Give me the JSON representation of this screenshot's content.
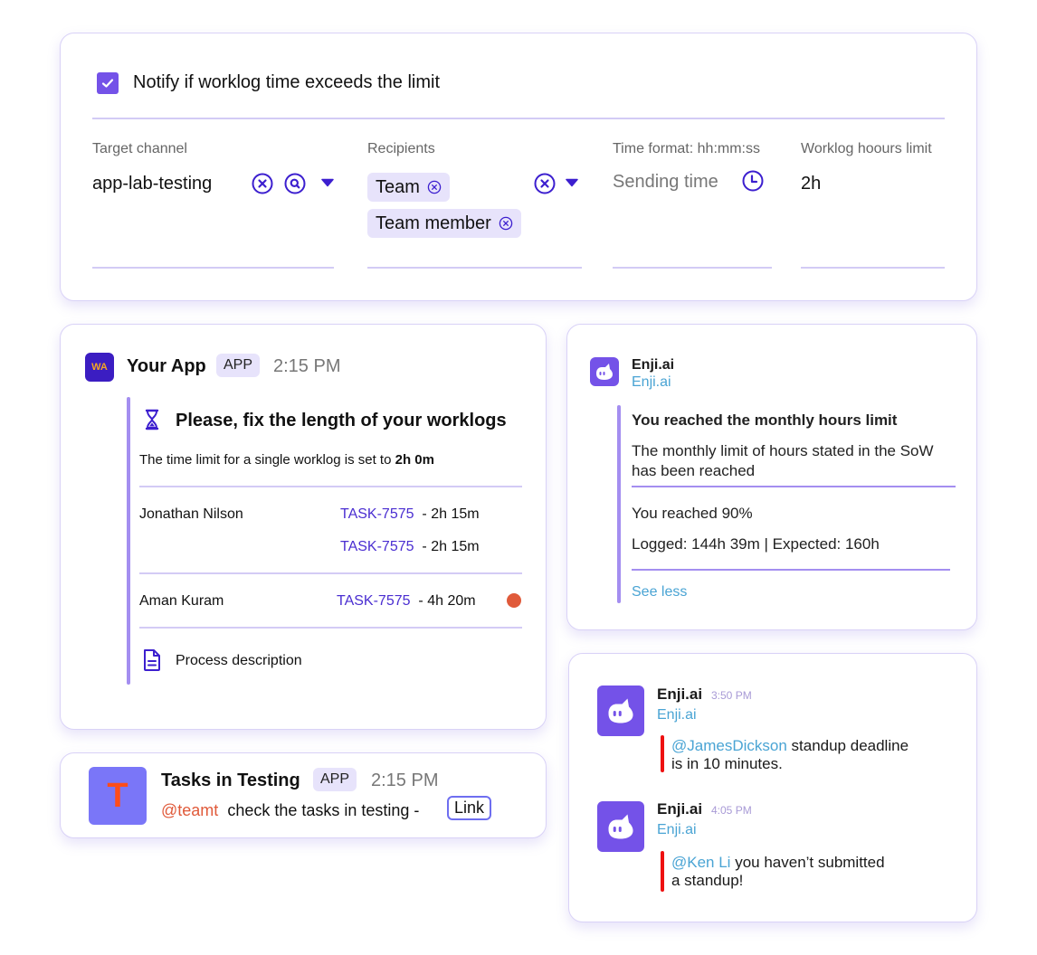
{
  "settings": {
    "notify_checked": true,
    "notify_label": "Notify if worklog time exceeds the limit",
    "target_channel": {
      "label": "Target channel",
      "value": "app-lab-testing",
      "icons": [
        "clear-icon",
        "search-icon",
        "dropdown-arrow-icon"
      ]
    },
    "recipients": {
      "label": "Recipients",
      "chips": [
        "Team",
        "Team member"
      ],
      "icons": [
        "clear-icon",
        "dropdown-arrow-icon"
      ]
    },
    "time_format": {
      "label": "Time format: hh:mm:ss",
      "placeholder": "Sending time",
      "icon": "clock-icon"
    },
    "worklog_limit": {
      "label": "Worklog hoours limit",
      "value": "2h"
    }
  },
  "your_app": {
    "avatar_initials": "WA",
    "name": "Your App",
    "badge": "APP",
    "time": "2:15 PM",
    "title": "Please, fix the length of your worklogs",
    "subtitle_prefix": "The time limit for a single worklog is set to ",
    "subtitle_value": "2h 0m",
    "rows": [
      {
        "person": "Jonathan Nilson",
        "task": "TASK-7575",
        "duration": "- 2h 15m"
      },
      {
        "person": "",
        "task": "TASK-7575",
        "duration": "- 2h 15m"
      },
      {
        "person": "Aman Kuram",
        "task": "TASK-7575",
        "duration": "- 4h 20m",
        "flag": "over-limit"
      }
    ],
    "footer_label": "Process description",
    "colors": {
      "accent": "#4a2ed1",
      "alert_dot": "#e05a3a",
      "quote_bar": "#a48ef0"
    }
  },
  "monthly": {
    "sender": "Enji.ai",
    "sender_sub": "Enji.ai",
    "title": "You reached the monthly hours limit",
    "body": "The monthly limit of hours stated in the SoW has been reached",
    "reached": "You reached 90%",
    "logged": "Logged: 144h 39m | Expected: 160h",
    "see_less": "See less"
  },
  "tasks": {
    "avatar_letter": "T",
    "name": "Tasks in Testing",
    "badge": "APP",
    "time": "2:15 PM",
    "mention": "@teamt",
    "text": "check the tasks in testing -",
    "link_label": "Link"
  },
  "standup": {
    "messages": [
      {
        "sender": "Enji.ai",
        "time": "3:50 PM",
        "sender_sub": "Enji.ai",
        "mention": "@JamesDickson",
        "text_line1": " standup deadline",
        "text_line2": "is in 10 minutes."
      },
      {
        "sender": "Enji.ai",
        "time": "4:05 PM",
        "sender_sub": "Enji.ai",
        "mention": "@Ken Li",
        "text_line1": " you haven’t submitted",
        "text_line2": "a standup!"
      }
    ]
  }
}
